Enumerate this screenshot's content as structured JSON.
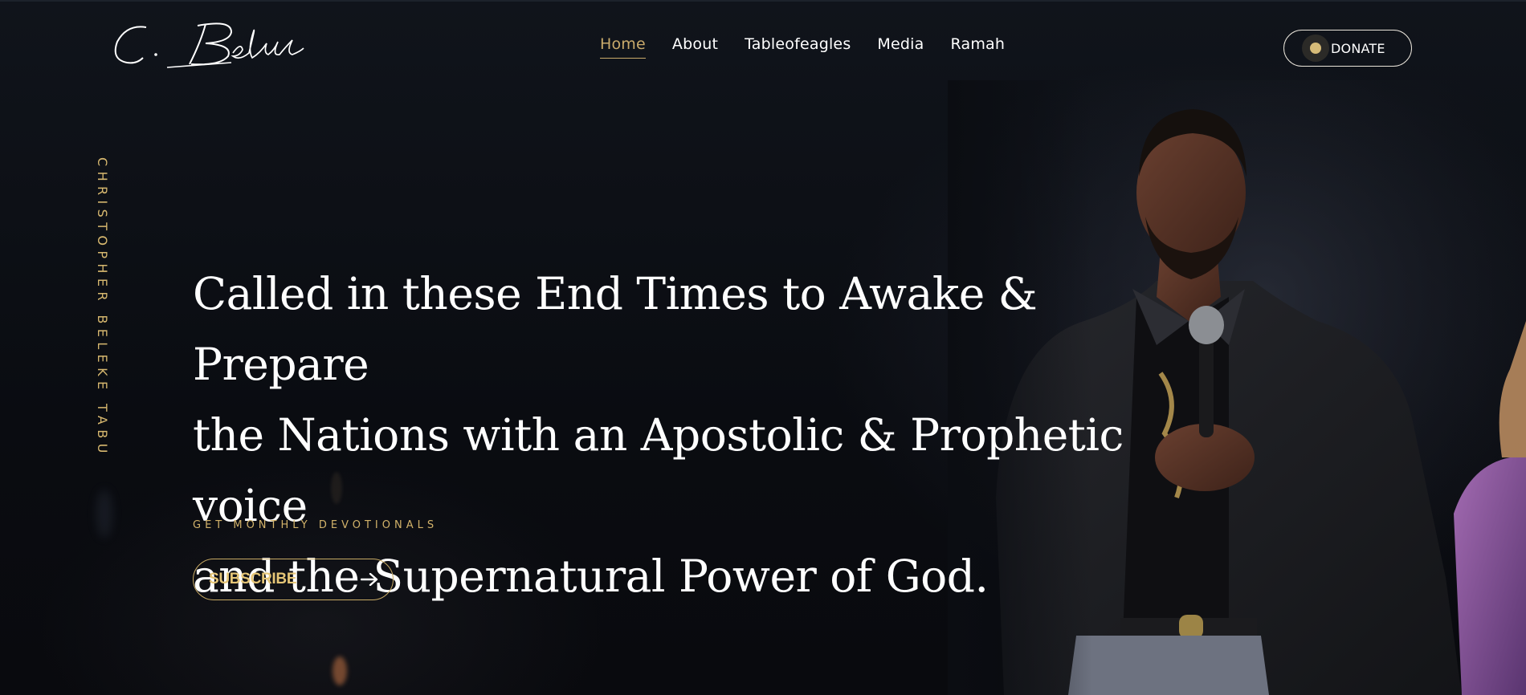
{
  "header": {
    "logo_text": "C. Beleke",
    "nav": [
      {
        "label": "Home",
        "active": true
      },
      {
        "label": "About",
        "active": false
      },
      {
        "label": "Tableofeagles",
        "active": false
      },
      {
        "label": "Media",
        "active": false
      },
      {
        "label": "Ramah",
        "active": false
      }
    ],
    "donate_label": "DONATE"
  },
  "hero": {
    "vertical_name": "CHRISTOPHER BELEKE TABU",
    "headline_lines": [
      "Called in these End Times to Awake & Prepare",
      "the Nations with an Apostolic & Prophetic voice",
      "and the Supernatural Power of God."
    ],
    "devotional_label": "GET MONTHLY DEVOTIONALS",
    "subscribe_label": "SUBSCRIBE",
    "subscribe_icon": "arrow-right-icon"
  },
  "colors": {
    "accent_gold": "#d6bb78",
    "background": "#0b0d12",
    "text": "#ffffff"
  }
}
